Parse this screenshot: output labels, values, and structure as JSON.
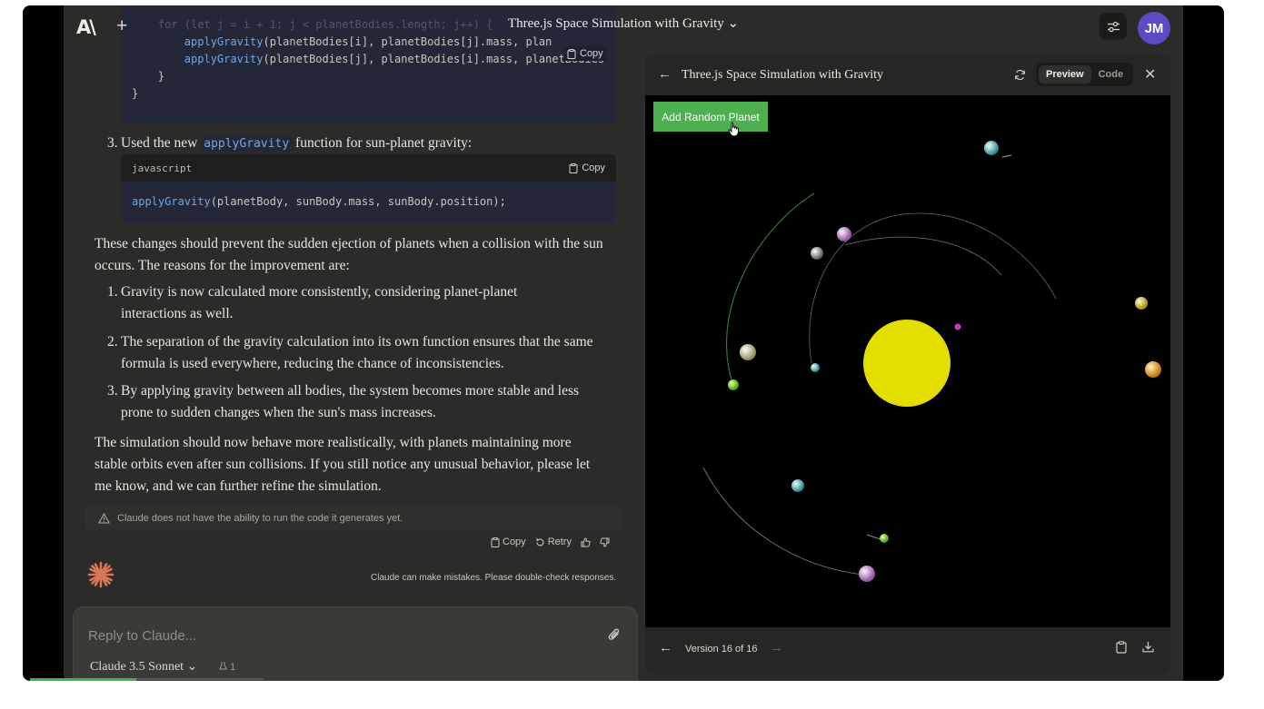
{
  "topbar": {
    "logo": "A\\",
    "new_chat": "+",
    "title": "Three.js Space Simulation with Gravity ⌄",
    "avatar_initials": "JM"
  },
  "chat": {
    "code1": {
      "faded_line": "    for (let j = i + 1; j < planetBodies.length; j++) {",
      "line1_fn": "applyGravity",
      "line1_rest": "(planetBodies[i], planetBodies[j].mass, plan",
      "line2_fn": "applyGravity",
      "line2_rest": "(planetBodies[j], planetBodies[i].mass, planetBodies",
      "line3": "    }",
      "line4": "}",
      "copy": "Copy"
    },
    "step3": {
      "num": "3.",
      "before": "Used the new ",
      "code": "applyGravity",
      "after": " function for sun-planet gravity:"
    },
    "code2": {
      "lang": "javascript",
      "copy": "Copy",
      "fn": "applyGravity",
      "rest": "(planetBody, sunBody.mass, sunBody.position);"
    },
    "para1": "These changes should prevent the sudden ejection of planets when a collision with the sun occurs. The reasons for the improvement are:",
    "reasons": [
      {
        "num": "1.",
        "text": "Gravity is now calculated more consistently, considering planet-planet interactions as well."
      },
      {
        "num": "2.",
        "text": "The separation of the gravity calculation into its own function ensures that the same formula is used everywhere, reducing the chance of inconsistencies."
      },
      {
        "num": "3.",
        "text": "By applying gravity between all bodies, the system becomes more stable and less prone to sudden changes when the sun's mass increases."
      }
    ],
    "para2": "The simulation should now behave more realistically, with planets maintaining more stable orbits even after sun collisions. If you still notice any unusual behavior, please let me know, and we can further refine the simulation.",
    "notice": "Claude does not have the ability to run the code it generates yet.",
    "actions": {
      "copy": "Copy",
      "retry": "Retry"
    },
    "disclaimer": "Claude can make mistakes. Please double-check responses."
  },
  "composer": {
    "placeholder": "Reply to Claude...",
    "model": "Claude 3.5 Sonnet ⌄",
    "token_count": "1"
  },
  "artifact": {
    "title": "Three.js Space Simulation with Gravity",
    "tabs": {
      "preview": "Preview",
      "code": "Code"
    },
    "active_tab": "Preview",
    "add_button": "Add Random Planet",
    "version": "Version 16 of 16",
    "sun_color": "#e3dd00",
    "button_color": "#4caf50"
  },
  "colors": {
    "app_bg": "#2b2b29",
    "code_bg": "#232737",
    "function_blue": "#6ea8e8",
    "avatar": "#5b4bc4",
    "claude_orange": "#d97757"
  }
}
